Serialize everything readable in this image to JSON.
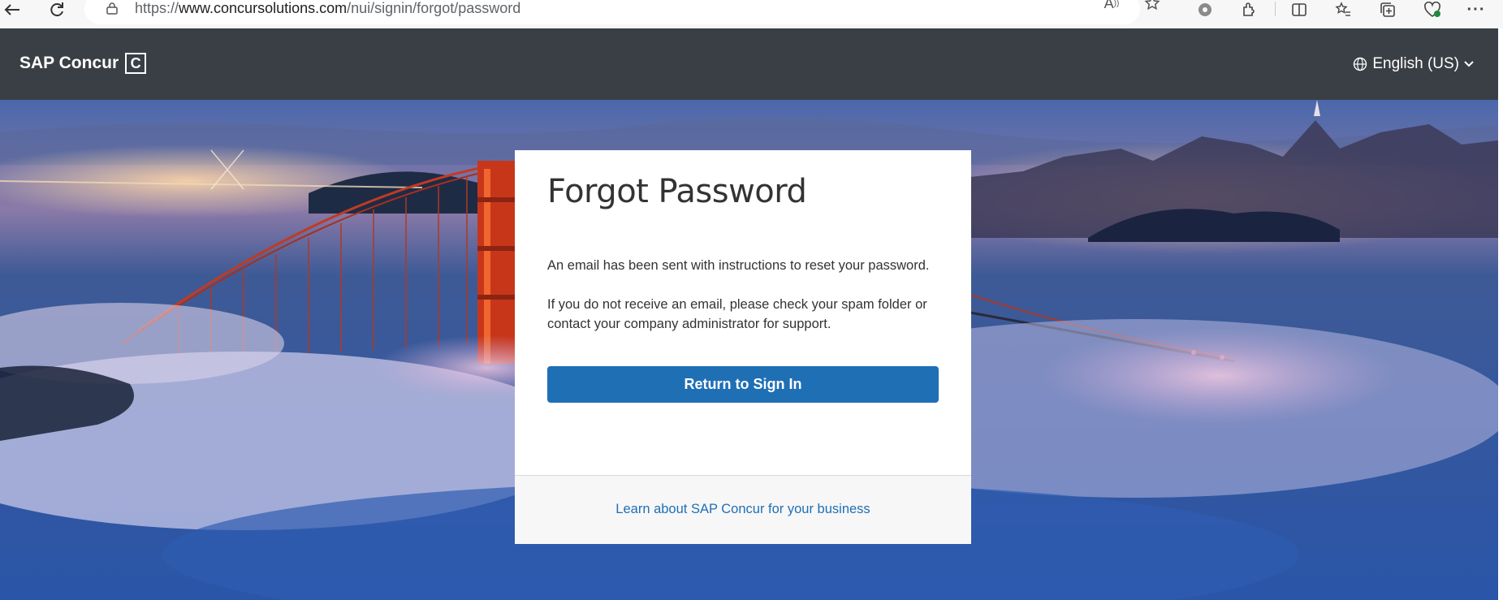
{
  "browser": {
    "url_prefix": "https://",
    "url_host": "www.concursolutions.com",
    "url_path": "/nui/signin/forgot/password",
    "icons": [
      "back-icon",
      "refresh-icon",
      "lock-icon",
      "read-aloud-icon",
      "favorite-star-icon",
      "settings-gear-icon",
      "extensions-icon",
      "split-screen-icon",
      "favorites-icon",
      "collections-icon",
      "browser-essentials-icon",
      "more-icon"
    ]
  },
  "header": {
    "logo_text": "SAP Concur",
    "logo_mark": "C",
    "language": "English (US)"
  },
  "card": {
    "title": "Forgot Password",
    "message_sent": "An email has been sent with instructions to reset your password.",
    "message_help": "If you do not receive an email, please check your spam folder or contact your company administrator for support.",
    "return_button": "Return to Sign In",
    "footer_link": "Learn about SAP Concur for your business"
  },
  "colors": {
    "header_bg": "#3a3f45",
    "button_bg": "#1f6fb5",
    "link": "#1f6fb5",
    "bridge": "#d23a1e"
  }
}
